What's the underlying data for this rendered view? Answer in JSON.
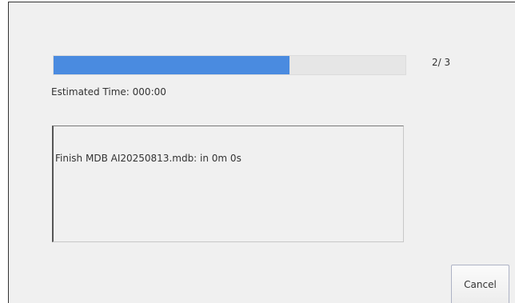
{
  "progress": {
    "fraction": 0.67,
    "count_text": "2/ 3",
    "accent_color": "#4a8be0"
  },
  "status": {
    "estimated_time": "Estimated Time: 000:00"
  },
  "log": {
    "lines": [
      "Finish MDB AI20250813.mdb: in 0m 0s"
    ]
  },
  "buttons": {
    "cancel_label": "Cancel"
  }
}
